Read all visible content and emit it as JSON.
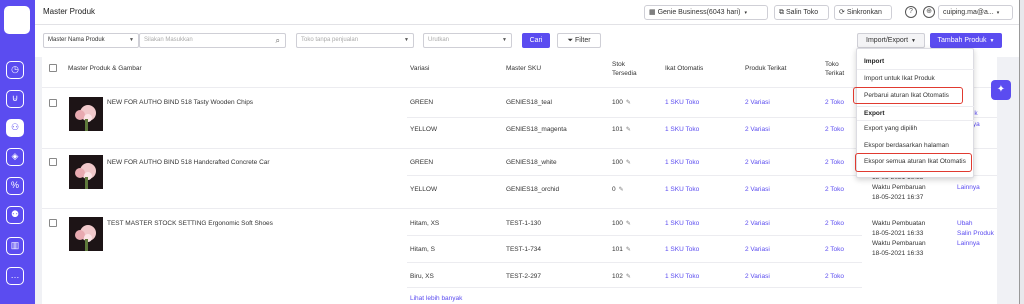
{
  "header": {
    "title": "Master Produk",
    "store_select": "Genie Business(6043 hari)",
    "copy_store": "Salin Toko",
    "sync": "Sinkronkan",
    "account": "cuiping.ma@a..."
  },
  "filters": {
    "field_select": "Master Nama Produk",
    "search_placeholder": "Silakan Masukkan",
    "store_placeholder": "Toko tanpa penjualan",
    "sort_placeholder": "Urutkan",
    "search_button": "Cari",
    "filter_button": "Filter"
  },
  "actions": {
    "import_export": "Import/Export",
    "add_product": "Tambah Produk"
  },
  "table": {
    "headers": {
      "product": "Master Produk & Gambar",
      "variant": "Variasi",
      "sku": "Master SKU",
      "stock_1": "Stok",
      "stock_2": "Tersedia",
      "auto_bind": "Ikat Otomatis",
      "bound_products": "Produk Terikat",
      "bound_stores_1": "Toko",
      "bound_stores_2": "Terikat"
    },
    "products": [
      {
        "name": "NEW FOR AUTHO BIND 518 Tasty Wooden Chips",
        "rows": [
          {
            "variant": "GREEN",
            "sku": "GENIES18_teal",
            "stock": "100",
            "auto": "1 SKU Toko",
            "bound": "2 Variasi",
            "stores": "2 Toko"
          },
          {
            "variant": "YELLOW",
            "sku": "GENIES18_magenta",
            "stock": "101",
            "auto": "1 SKU Toko",
            "bound": "2 Variasi",
            "stores": "2 Toko"
          }
        ],
        "side_links": [
          "Produk",
          "Lainnya"
        ]
      },
      {
        "name": "NEW FOR AUTHO BIND 518 Handcrafted Concrete Car",
        "rows": [
          {
            "variant": "GREEN",
            "sku": "GENIES18_white",
            "stock": "100",
            "auto": "1 SKU Toko",
            "bound": "2 Variasi",
            "stores": "2 Toko"
          },
          {
            "variant": "YELLOW",
            "sku": "GENIES18_orchid",
            "stock": "0",
            "auto": "1 SKU Toko",
            "bound": "2 Variasi",
            "stores": "2 Toko"
          }
        ],
        "time_date": "18-05-2021 16:35",
        "update_label": "Waktu Pembaruan",
        "update_time": "18-05-2021 16:37",
        "side_link": "Lainnya"
      },
      {
        "name": "TEST MASTER STOCK SETTING Ergonomic Soft Shoes",
        "rows": [
          {
            "variant": "Hitam, XS",
            "sku": "TEST-1-130",
            "stock": "100",
            "auto": "1 SKU Toko",
            "bound": "2 Variasi",
            "stores": "2 Toko"
          },
          {
            "variant": "Hitam, S",
            "sku": "TEST-1-734",
            "stock": "101",
            "auto": "1 SKU Toko",
            "bound": "2 Variasi",
            "stores": "2 Toko"
          },
          {
            "variant": "Biru, XS",
            "sku": "TEST-2-297",
            "stock": "102",
            "auto": "1 SKU Toko",
            "bound": "2 Variasi",
            "stores": "2 Toko"
          }
        ],
        "create_label": "Waktu Pembuatan",
        "create_time": "18-05-2021 16:33",
        "update_label": "Waktu Pembaruan",
        "update_time": "18-05-2021 16:33",
        "edit_link": "Ubah",
        "copy_link": "Salin Produk",
        "more_link": "Lainnya"
      }
    ],
    "see_more": "Lihat lebih banyak"
  },
  "dropdown": {
    "import_header": "Import",
    "import_product": "Import untuk Ikat Produk",
    "update_rules": "Perbarui aturan Ikat Otomatis",
    "export_header": "Export",
    "export_selected": "Export yang dipilih",
    "export_page": "Ekspor berdasarkan halaman",
    "export_all_rules": "Ekspor semua aturan Ikat Otomatis"
  },
  "colors": {
    "accent": "#5b4cf0",
    "highlight": "#e03a30"
  },
  "icons": [
    "dashboard-icon",
    "cart-icon",
    "product-tree-icon",
    "package-icon",
    "percent-icon",
    "users-icon",
    "chart-icon",
    "chat-icon",
    "calendar-icon",
    "copy-icon",
    "sync-icon",
    "help-icon",
    "globe-icon",
    "search-icon",
    "filter-icon",
    "lightbulb-icon",
    "edit-icon"
  ]
}
